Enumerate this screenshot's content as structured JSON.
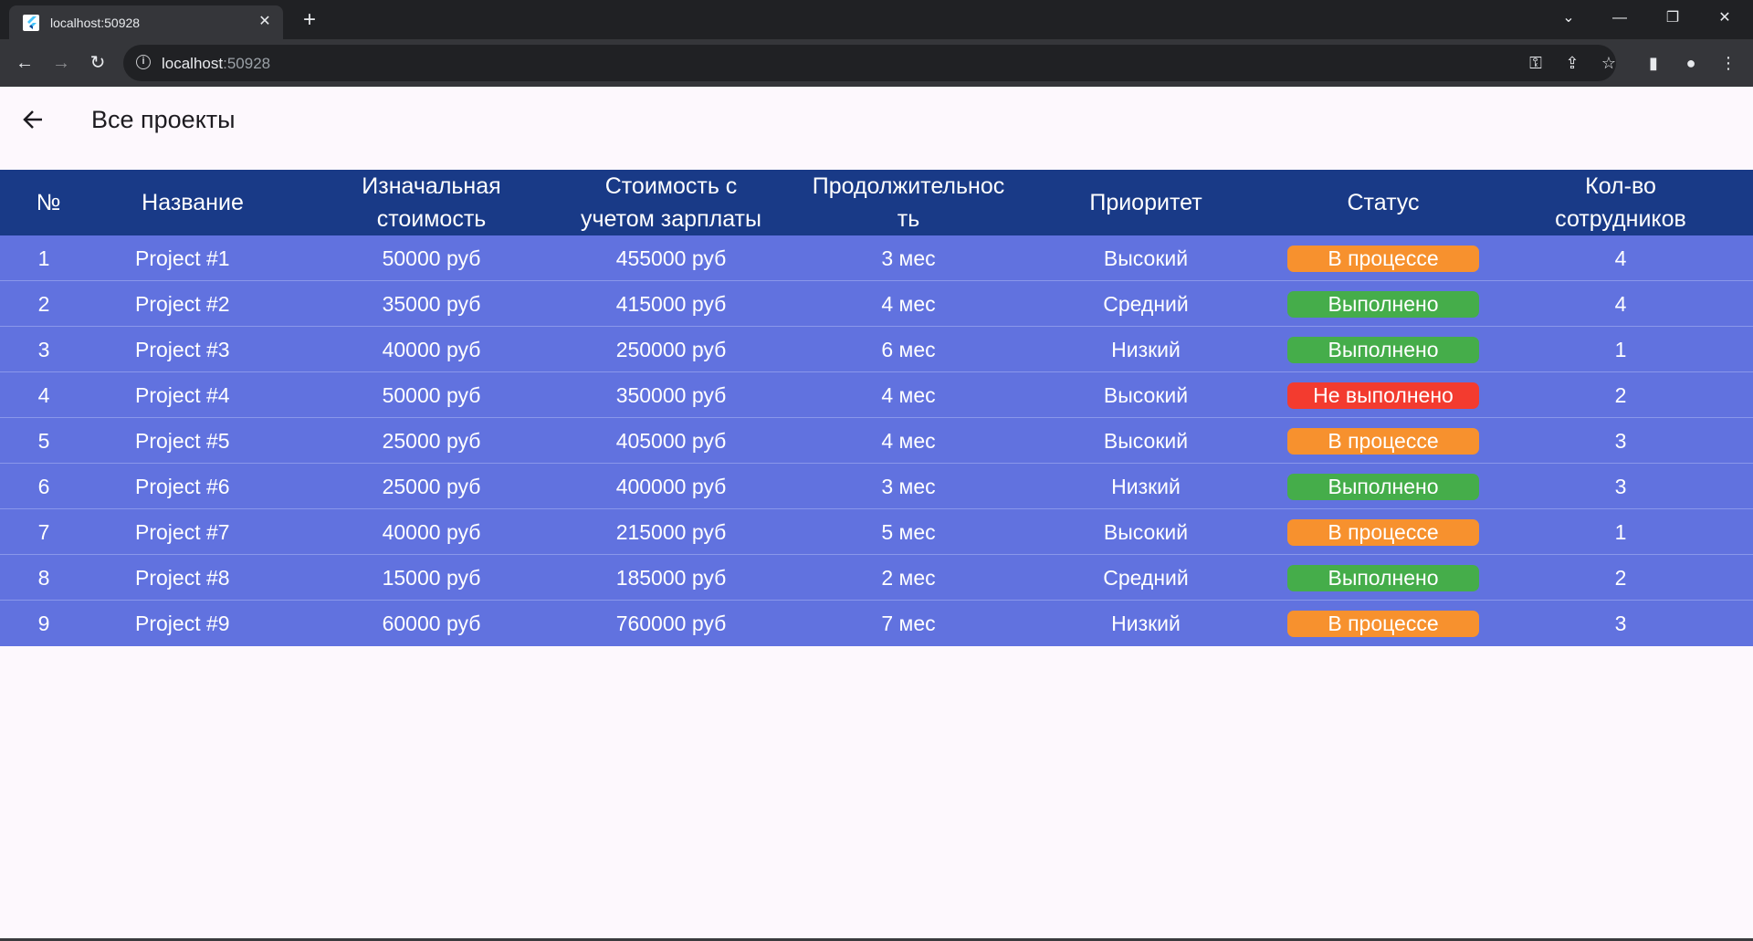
{
  "browser": {
    "tab_title": "localhost:50928",
    "url_host": "localhost",
    "url_port": ":50928"
  },
  "app": {
    "title": "Все проекты"
  },
  "table": {
    "headers": [
      "№",
      "Название",
      "Изначальная\nстоимость",
      "Стоимость с\nучетом зарплаты",
      "Продолжительнос\nть",
      "Приоритет",
      "Статус",
      "Кол-во\nсотрудников"
    ],
    "rows": [
      {
        "num": "1",
        "name": "Project #1",
        "initial_cost": "50000 руб",
        "total_cost": "455000 руб",
        "duration": "3 мес",
        "priority": "Высокий",
        "status": "В процессе",
        "status_kind": "progress",
        "employees": "4"
      },
      {
        "num": "2",
        "name": "Project #2",
        "initial_cost": "35000 руб",
        "total_cost": "415000 руб",
        "duration": "4 мес",
        "priority": "Средний",
        "status": "Выполнено",
        "status_kind": "done",
        "employees": "4"
      },
      {
        "num": "3",
        "name": "Project #3",
        "initial_cost": "40000 руб",
        "total_cost": "250000 руб",
        "duration": "6 мес",
        "priority": "Низкий",
        "status": "Выполнено",
        "status_kind": "done",
        "employees": "1"
      },
      {
        "num": "4",
        "name": "Project #4",
        "initial_cost": "50000 руб",
        "total_cost": "350000 руб",
        "duration": "4 мес",
        "priority": "Высокий",
        "status": "Не выполнено",
        "status_kind": "fail",
        "employees": "2"
      },
      {
        "num": "5",
        "name": "Project #5",
        "initial_cost": "25000 руб",
        "total_cost": "405000 руб",
        "duration": "4 мес",
        "priority": "Высокий",
        "status": "В процессе",
        "status_kind": "progress",
        "employees": "3"
      },
      {
        "num": "6",
        "name": "Project #6",
        "initial_cost": "25000 руб",
        "total_cost": "400000 руб",
        "duration": "3 мес",
        "priority": "Низкий",
        "status": "Выполнено",
        "status_kind": "done",
        "employees": "3"
      },
      {
        "num": "7",
        "name": "Project #7",
        "initial_cost": "40000 руб",
        "total_cost": "215000 руб",
        "duration": "5 мес",
        "priority": "Высокий",
        "status": "В процессе",
        "status_kind": "progress",
        "employees": "1"
      },
      {
        "num": "8",
        "name": "Project #8",
        "initial_cost": "15000 руб",
        "total_cost": "185000 руб",
        "duration": "2 мес",
        "priority": "Средний",
        "status": "Выполнено",
        "status_kind": "done",
        "employees": "2"
      },
      {
        "num": "9",
        "name": "Project #9",
        "initial_cost": "60000 руб",
        "total_cost": "760000 руб",
        "duration": "7 мес",
        "priority": "Низкий",
        "status": "В процессе",
        "status_kind": "progress",
        "employees": "3"
      }
    ]
  },
  "colors": {
    "header_bg": "#193a87",
    "row_bg": "#6172df",
    "status_progress": "#f7912e",
    "status_done": "#45ad4a",
    "status_fail": "#f33b2f"
  }
}
